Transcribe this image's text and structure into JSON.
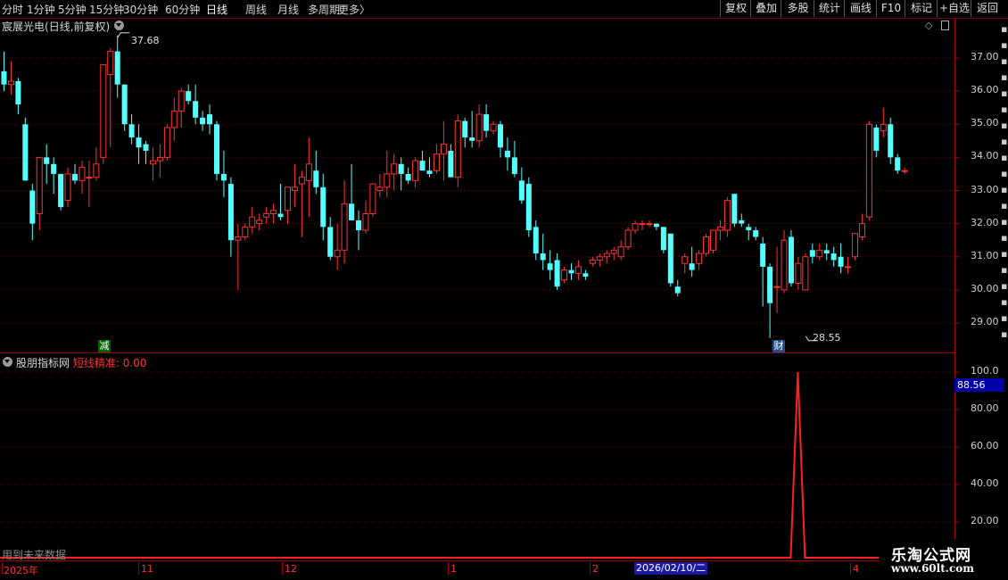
{
  "toolbar": {
    "periods": [
      "分时",
      "1分钟",
      "5分钟",
      "15分钟",
      "30分钟",
      "60分钟",
      "日线",
      "周线",
      "月线",
      "多周期",
      "更多"
    ],
    "active_period": "日线",
    "buttons": [
      "复权",
      "叠加",
      "多股",
      "统计",
      "画线",
      "F10",
      "标记",
      "+自选",
      "返回"
    ]
  },
  "main_chart": {
    "stock_name": "宸展光电",
    "mode": "(日线,前复权)",
    "high_marker": "37.68",
    "low_marker": "28.55",
    "event_badges": [
      "减",
      "财"
    ],
    "y_ticks": [
      "37.00",
      "36.00",
      "35.00",
      "34.00",
      "33.00",
      "32.00",
      "31.00",
      "30.00",
      "29.00"
    ]
  },
  "indicator": {
    "name": "股朋指标网",
    "label": "短线精准:",
    "value": "0.00",
    "current_value_box": "88.56",
    "y_ticks": [
      "100.0",
      "80.00",
      "60.00",
      "40.00",
      "20.00"
    ],
    "footer_note": "用到未来数据"
  },
  "x_axis": {
    "labels": [
      "2025年",
      "11",
      "12",
      "1",
      "2",
      "2026/02/10/二",
      "4"
    ]
  },
  "watermark": {
    "title": "乐淘公式网",
    "url": "www.60lt.com"
  },
  "colors": {
    "up": "#ff3232",
    "down": "#54ffff",
    "grid": "#5a0000",
    "axis": "#a00000"
  },
  "chart_data": {
    "type": "candlestick",
    "ylim": [
      28.3,
      37.9
    ],
    "candles": [
      [
        36.6,
        37.2,
        36.0,
        36.2
      ],
      [
        36.2,
        36.9,
        35.9,
        36.3
      ],
      [
        36.3,
        36.4,
        35.3,
        35.6
      ],
      [
        35.0,
        35.2,
        33.3,
        33.3
      ],
      [
        33.0,
        33.2,
        31.5,
        32.0
      ],
      [
        32.3,
        33.8,
        31.8,
        34.0
      ],
      [
        34.0,
        34.4,
        33.2,
        33.8
      ],
      [
        33.8,
        34.0,
        32.9,
        33.5
      ],
      [
        33.5,
        33.5,
        32.4,
        32.5
      ],
      [
        32.7,
        33.7,
        32.5,
        33.5
      ],
      [
        33.5,
        33.8,
        33.2,
        33.3
      ],
      [
        33.3,
        33.9,
        32.9,
        33.7
      ],
      [
        33.4,
        33.9,
        32.5,
        33.4
      ],
      [
        33.4,
        34.3,
        33.3,
        33.8
      ],
      [
        34.0,
        36.8,
        33.8,
        36.8
      ],
      [
        36.5,
        37.3,
        34.3,
        37.2
      ],
      [
        37.2,
        37.68,
        35.8,
        36.2
      ],
      [
        36.2,
        36.2,
        34.8,
        35.0
      ],
      [
        35.0,
        35.3,
        34.4,
        34.6
      ],
      [
        34.6,
        35.0,
        33.8,
        34.3
      ],
      [
        34.4,
        34.5,
        33.8,
        34.2
      ],
      [
        33.8,
        34.3,
        33.3,
        33.9
      ],
      [
        33.9,
        34.4,
        33.4,
        34.0
      ],
      [
        34.0,
        35.0,
        33.9,
        34.9
      ],
      [
        34.9,
        35.8,
        34.5,
        35.4
      ],
      [
        35.4,
        36.1,
        34.9,
        36.0
      ],
      [
        36.0,
        36.2,
        35.6,
        35.7
      ],
      [
        35.7,
        36.2,
        35.0,
        35.2
      ],
      [
        35.2,
        35.4,
        34.8,
        35.0
      ],
      [
        35.3,
        35.6,
        34.7,
        35.0
      ],
      [
        35.0,
        35.1,
        33.3,
        33.5
      ],
      [
        33.5,
        34.2,
        32.8,
        33.3
      ],
      [
        33.2,
        33.4,
        31.0,
        31.5
      ],
      [
        31.5,
        32.0,
        30.0,
        31.6
      ],
      [
        31.6,
        32.0,
        31.5,
        31.9
      ],
      [
        31.9,
        32.5,
        31.7,
        32.2
      ],
      [
        32.0,
        32.3,
        31.8,
        32.1
      ],
      [
        32.2,
        32.5,
        32.0,
        32.3
      ],
      [
        32.3,
        32.6,
        32.0,
        32.4
      ],
      [
        32.3,
        33.2,
        32.1,
        32.2
      ],
      [
        32.4,
        33.1,
        32.0,
        33.1
      ],
      [
        33.0,
        33.8,
        32.5,
        33.1
      ],
      [
        33.2,
        33.6,
        31.6,
        33.4
      ],
      [
        33.3,
        34.6,
        32.2,
        33.8
      ],
      [
        33.6,
        34.2,
        32.9,
        33.1
      ],
      [
        33.1,
        33.5,
        31.5,
        31.9
      ],
      [
        31.9,
        32.2,
        30.9,
        31.0
      ],
      [
        31.0,
        32.0,
        30.6,
        31.2
      ],
      [
        31.2,
        33.3,
        30.8,
        32.6
      ],
      [
        32.6,
        33.8,
        32.1,
        32.1
      ],
      [
        32.1,
        32.4,
        31.2,
        31.8
      ],
      [
        31.8,
        32.7,
        31.7,
        32.3
      ],
      [
        32.3,
        33.2,
        32.2,
        33.2
      ],
      [
        33.0,
        33.5,
        32.8,
        33.1
      ],
      [
        33.1,
        34.2,
        32.8,
        33.5
      ],
      [
        33.5,
        34.1,
        33.0,
        33.8
      ],
      [
        33.8,
        34.0,
        33.0,
        33.5
      ],
      [
        33.5,
        33.7,
        33.2,
        33.3
      ],
      [
        33.3,
        34.0,
        33.1,
        33.9
      ],
      [
        33.9,
        34.2,
        33.6,
        33.6
      ],
      [
        33.6,
        34.0,
        33.4,
        33.5
      ],
      [
        33.6,
        34.4,
        33.5,
        34.1
      ],
      [
        34.1,
        35.1,
        33.3,
        34.4
      ],
      [
        34.2,
        34.4,
        33.4,
        33.4
      ],
      [
        33.4,
        35.3,
        33.1,
        35.1
      ],
      [
        35.1,
        35.2,
        34.3,
        34.6
      ],
      [
        34.6,
        35.4,
        34.3,
        34.5
      ],
      [
        34.5,
        35.6,
        34.3,
        35.3
      ],
      [
        35.3,
        35.6,
        34.6,
        34.8
      ],
      [
        34.8,
        35.1,
        34.7,
        35.0
      ],
      [
        35.0,
        35.1,
        34.0,
        34.3
      ],
      [
        34.2,
        34.6,
        33.6,
        34.0
      ],
      [
        34.0,
        34.5,
        33.4,
        33.5
      ],
      [
        33.3,
        33.7,
        32.6,
        32.7
      ],
      [
        33.2,
        33.4,
        31.6,
        31.8
      ],
      [
        31.9,
        32.1,
        30.9,
        31.1
      ],
      [
        31.1,
        31.7,
        30.6,
        30.9
      ],
      [
        30.8,
        31.2,
        30.3,
        30.6
      ],
      [
        30.9,
        31.1,
        30.0,
        30.1
      ],
      [
        30.3,
        30.7,
        30.2,
        30.6
      ],
      [
        30.6,
        30.8,
        30.3,
        30.5
      ],
      [
        30.5,
        30.9,
        30.3,
        30.7
      ],
      [
        30.5,
        30.6,
        30.3,
        30.4
      ],
      [
        30.8,
        31.0,
        30.7,
        30.9
      ],
      [
        30.9,
        31.1,
        30.7,
        31.0
      ],
      [
        31.0,
        31.2,
        30.8,
        31.1
      ],
      [
        31.1,
        31.3,
        30.9,
        31.2
      ],
      [
        31.0,
        31.5,
        30.9,
        31.3
      ],
      [
        31.3,
        31.9,
        31.2,
        31.8
      ],
      [
        31.8,
        32.1,
        31.7,
        32.0
      ],
      [
        32.0,
        32.1,
        31.8,
        32.0
      ],
      [
        32.0,
        32.1,
        31.9,
        32.0
      ],
      [
        32.0,
        32.0,
        31.8,
        31.9
      ],
      [
        31.9,
        31.9,
        31.1,
        31.2
      ],
      [
        31.7,
        31.7,
        30.1,
        30.2
      ],
      [
        30.1,
        30.3,
        29.8,
        29.9
      ],
      [
        30.8,
        31.1,
        30.5,
        31.0
      ],
      [
        30.8,
        31.3,
        30.4,
        30.6
      ],
      [
        30.8,
        31.2,
        30.6,
        31.1
      ],
      [
        31.1,
        31.7,
        31.0,
        31.6
      ],
      [
        31.2,
        31.8,
        31.1,
        31.8
      ],
      [
        31.8,
        32.1,
        31.5,
        31.9
      ],
      [
        31.8,
        32.8,
        31.6,
        32.7
      ],
      [
        32.9,
        32.9,
        31.9,
        32.0
      ],
      [
        32.1,
        32.3,
        31.9,
        32.0
      ],
      [
        31.9,
        32.0,
        31.5,
        31.8
      ],
      [
        31.8,
        31.9,
        31.5,
        31.6
      ],
      [
        31.4,
        31.6,
        29.5,
        30.7
      ],
      [
        30.7,
        30.8,
        28.55,
        29.6
      ],
      [
        30.1,
        31.3,
        29.3,
        30.1
      ],
      [
        30.0,
        31.8,
        29.9,
        31.5
      ],
      [
        31.6,
        31.8,
        30.1,
        30.2
      ],
      [
        30.2,
        31.0,
        30.0,
        30.8
      ],
      [
        30.0,
        31.1,
        30.0,
        31.0
      ],
      [
        31.2,
        31.4,
        30.8,
        31.0
      ],
      [
        31.0,
        31.4,
        30.9,
        31.2
      ],
      [
        31.2,
        31.4,
        30.9,
        31.1
      ],
      [
        31.1,
        31.3,
        30.7,
        30.9
      ],
      [
        31.0,
        31.4,
        30.5,
        30.7
      ],
      [
        30.7,
        31.0,
        30.5,
        30.7
      ],
      [
        31.0,
        31.7,
        30.9,
        31.7
      ],
      [
        31.6,
        32.3,
        31.5,
        32.0
      ],
      [
        32.2,
        35.1,
        32.1,
        35.0
      ],
      [
        34.9,
        35.0,
        34.0,
        34.2
      ],
      [
        34.8,
        35.5,
        34.6,
        35.0
      ],
      [
        35.0,
        35.2,
        33.8,
        34.0
      ],
      [
        34.0,
        34.1,
        33.5,
        33.6
      ],
      [
        33.6,
        33.7,
        33.5,
        33.6
      ]
    ],
    "indicator_series": {
      "name": "短线精准",
      "signal_index": 112,
      "signal_value": 100,
      "ylim": [
        0,
        107
      ]
    }
  }
}
